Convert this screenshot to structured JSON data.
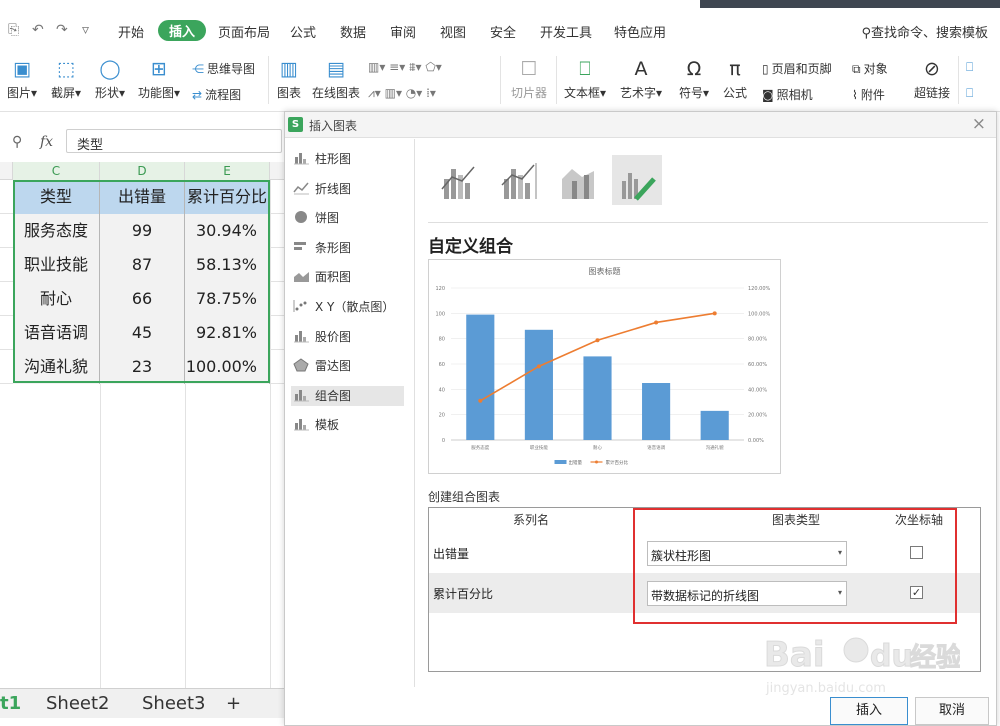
{
  "toolbar": {
    "tabs": [
      "开始",
      "插入",
      "页面布局",
      "公式",
      "数据",
      "审阅",
      "视图",
      "安全",
      "开发工具",
      "特色应用"
    ],
    "active_tab": "插入",
    "search": "查找命令、搜索模板"
  },
  "ribbon": {
    "big": [
      "图片",
      "截屏",
      "形状",
      "功能图",
      "图表",
      "在线图表",
      "切片器",
      "文本框",
      "艺术字",
      "符号",
      "公式",
      "超链接"
    ],
    "small": {
      "mindmap": "思维导图",
      "flowchart": "流程图",
      "header_footer": "页眉和页脚",
      "object": "对象",
      "camera": "照相机",
      "attachment": "附件"
    }
  },
  "formula_bar": {
    "fx": "fx",
    "value": "类型"
  },
  "sheet": {
    "columns": [
      "C",
      "D",
      "E"
    ],
    "header": [
      "类型",
      "出错量",
      "累计百分比"
    ],
    "rows": [
      [
        "服务态度",
        "99",
        "30.94%"
      ],
      [
        "职业技能",
        "87",
        "58.13%"
      ],
      [
        "耐心",
        "66",
        "78.75%"
      ],
      [
        "语音语调",
        "45",
        "92.81%"
      ],
      [
        "沟通礼貌",
        "23",
        "100.00%"
      ]
    ],
    "tabs": [
      "t1",
      "Sheet2",
      "Sheet3"
    ],
    "add": "+"
  },
  "dialog": {
    "title": "插入图表",
    "close": "×",
    "logo": "S",
    "side_items": [
      "柱形图",
      "折线图",
      "饼图",
      "条形图",
      "面积图",
      "X Y（散点图）",
      "股价图",
      "雷达图",
      "组合图",
      "模板"
    ],
    "active_item": "组合图",
    "section_title": "自定义组合",
    "create_label": "创建组合图表",
    "table_headers": [
      "系列名",
      "图表类型",
      "次坐标轴"
    ],
    "series": [
      {
        "name": "出错量",
        "type": "簇状柱形图",
        "secondary": false
      },
      {
        "name": "累计百分比",
        "type": "带数据标记的折线图",
        "secondary": true
      }
    ],
    "check_mark": "✓",
    "insert": "插入",
    "cancel": "取消"
  },
  "chart_data": {
    "type": "bar",
    "title": "图表标题",
    "categories": [
      "服务态度",
      "职业技能",
      "耐心",
      "语音语调",
      "沟通礼貌"
    ],
    "series": [
      {
        "name": "出错量",
        "type": "bar",
        "values": [
          99,
          87,
          66,
          45,
          23
        ]
      },
      {
        "name": "累计百分比",
        "type": "line",
        "axis": "secondary",
        "values": [
          30.94,
          58.13,
          78.75,
          92.81,
          100.0
        ]
      }
    ],
    "ylim": [
      0,
      120
    ],
    "y_ticks": [
      "0",
      "20",
      "40",
      "60",
      "80",
      "100",
      "120"
    ],
    "y2lim": [
      0,
      120
    ],
    "y2_ticks": [
      "0.00%",
      "20.00%",
      "40.00%",
      "60.00%",
      "80.00%",
      "100.00%",
      "120.00%"
    ],
    "legend": "bottom",
    "colors": {
      "bar": "#5b9bd5",
      "line": "#ed7d31"
    }
  },
  "watermark": {
    "text1": "Bai",
    "text2": "du",
    "text3": "经验",
    "url": "jingyan.baidu.com"
  }
}
